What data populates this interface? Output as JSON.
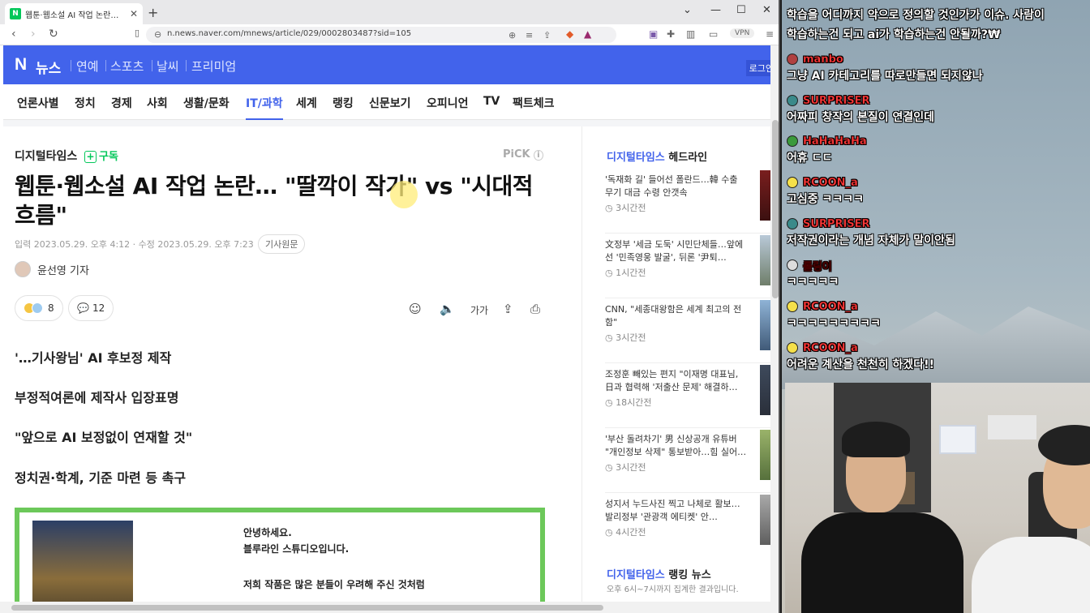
{
  "browser": {
    "tab_title": "웹툰·웹소설 AI 작업 논란… \"딸깍이",
    "favicon": "N",
    "url": "n.news.naver.com/mnews/article/029/0002803487?sid=105",
    "vpn": "VPN"
  },
  "naver": {
    "logo": "N",
    "news": "뉴스",
    "sections": [
      "연예",
      "스포츠",
      "날씨",
      "프리미엄"
    ],
    "login": "로그인"
  },
  "categories": [
    "언론사별",
    "정치",
    "경제",
    "사회",
    "생활/문화",
    "IT/과학",
    "세계",
    "랭킹",
    "신문보기",
    "오피니언",
    "TV",
    "팩트체크"
  ],
  "article": {
    "publisher": "디지털타임스",
    "subscribe": "구독",
    "pick": "PiCK",
    "headline": "웹툰·웹소설 AI 작업 논란… \"딸깍이 작가\" vs \"시대적 흐름\"",
    "meta": "입력 2023.05.29. 오후 4:12 · 수정 2023.05.29. 오후 7:23",
    "original": "기사원문",
    "reporter": "윤선영 기자",
    "reaction_count": "8",
    "comment_count": "12",
    "font_label": "가가",
    "summary": [
      "'…기사왕님' AI 후보정 제작",
      "부정적여론에 제작사 입장표명",
      "\"앞으로 AI 보정없이 연재할 것\"",
      "정치권·학계, 기준 마련 등 촉구"
    ],
    "image_lines": [
      "안녕하세요.",
      "블루라인 스튜디오입니다.",
      "저희 작품은 많은 분들이 우려해 주신 것처럼"
    ]
  },
  "sidebar": {
    "publisher": "디지털타임스",
    "heading": "헤드라인",
    "items": [
      {
        "title": "'독재화 길' 들어선 폴란드…韓 수출 무기 대금 수령 안갯속",
        "time": "3시간전"
      },
      {
        "title": "文정부 '세금 도둑' 시민단체들…앞에선 '민족영웅 발굴', 뒤론 '尹퇴…",
        "time": "1시간전"
      },
      {
        "title": "CNN, \"세종대왕함은 세계 최고의 전함\"",
        "time": "3시간전"
      },
      {
        "title": "조정훈 빼있는 편지 \"이재명 대표님, 日과 협력해 '저출산 문제' 해결하…",
        "time": "18시간전"
      },
      {
        "title": "'부산 돌려차기' 男 신상공개 유튜버 \"개인정보 삭제\" 통보받아…힘 실어…",
        "time": "3시간전"
      },
      {
        "title": "성지서 누드사진 찍고 나체로 활보…발리정부 '관광객 에티켓' 안…",
        "time": "4시간전"
      }
    ],
    "ranking_heading": "랭킹 뉴스",
    "ranking_desc": "오후 6시~7시까지 집계한 결과입니다."
  },
  "chat": [
    {
      "name": "",
      "msg": "학습을 어디까지 악으로 정의할 것인가가 이슈. 사람이",
      "badge_color": "#888888"
    },
    {
      "name": "",
      "msg": "학습하는건 되고 ai가 학습하는건 안될까?₩",
      "badge_color": "#888888"
    },
    {
      "name": "manbo",
      "msg": "그냥 AI 카테고리를 따로만들면 되지않나",
      "badge_color": "#b04040"
    },
    {
      "name": "SURPRISER",
      "msg": "어짜피 창작의 본질이 연결인데",
      "badge_color": "#3a8a8a"
    },
    {
      "name": "HaHaHaHa",
      "msg": "어휴 ㄷㄷ",
      "badge_color": "#3b9a3b"
    },
    {
      "name": "RCOON_a",
      "msg": "고심중 ㅋㅋㅋㅋ",
      "badge_color": "#f5e04a"
    },
    {
      "name": "SURPRISER",
      "msg": "저작권이라는 개념 자체가 말이안됨",
      "badge_color": "#3a8a8a"
    },
    {
      "name": "롤링이",
      "msg": "ㅋㅋㅋㅋㅋ",
      "badge_color": "#dddddd"
    },
    {
      "name": "RCOON_a",
      "msg": "ㅋㅋㅋㅋㅋㅋㅋㅋㅋ",
      "badge_color": "#f5e04a"
    },
    {
      "name": "RCOON_a",
      "msg": "어려운 계산을 천천히 하겠다!!",
      "badge_color": "#f5e04a"
    }
  ]
}
